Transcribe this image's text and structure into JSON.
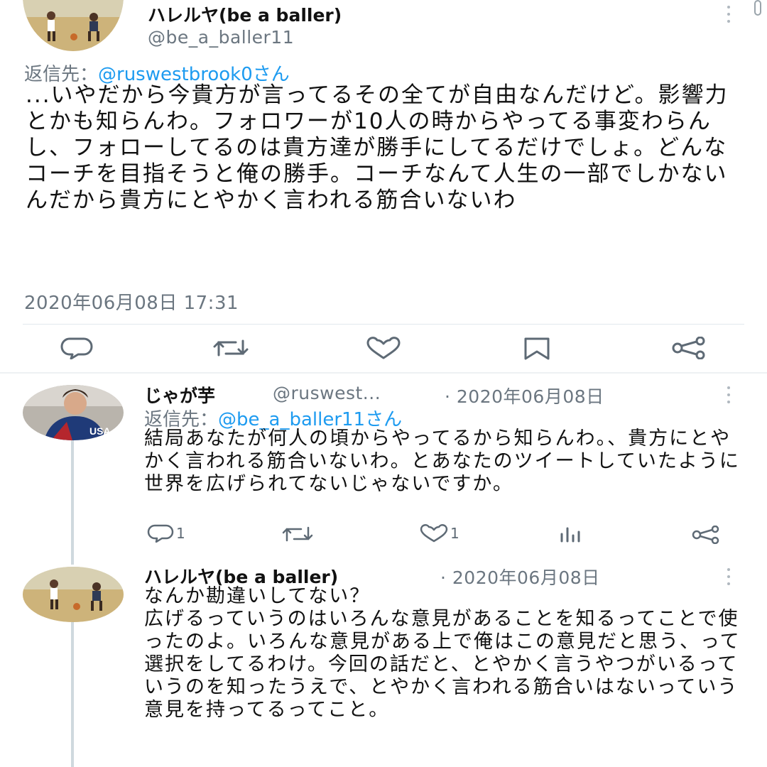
{
  "main_tweet": {
    "display_name": "ハレルヤ(be a baller)",
    "handle": "@be_a_baller11",
    "reply_prefix": "返信先：",
    "reply_to": "@ruswestbrook0さん",
    "text": "...いやだから今貴方が言ってるその全てが自由なんだけど。影響力とかも知らんわ。フォロワーが10人の時からやってる事変わらんし、フォローしてるのは貴方達が勝手にしてるだけでしょ。どんなコーチを目指そうと俺の勝手。コーチなんて人生の一部でしかないんだから貴方にとやかく言われる筋合いないわ",
    "timestamp": "2020年06月08日 17:31",
    "actions": [
      "reply-icon",
      "retweet-icon",
      "like-icon",
      "bookmark-icon",
      "share-icon"
    ]
  },
  "replies": [
    {
      "display_name": "じゃが芋",
      "handle": "@ruswest...",
      "date": "· 2020年06月08日",
      "reply_prefix": "返信先：",
      "reply_to": "@be_a_baller11さん",
      "text": "結局あなたが何人の頃からやってるから知らんわ。、貴方にとやかく言われる筋合いないわ。とあなたのツイートしていたように世界を広げられてないじゃないですか。",
      "reply_count": "1",
      "retweet_count": "",
      "like_count": "1"
    },
    {
      "display_name": "ハレルヤ(be a baller)",
      "date": "· 2020年06月08日",
      "text_lines": [
        "なんか勘違いしてない？",
        "広げるっていうのはいろんな意見があることを知るってことで使ったのよ。いろんな意見がある上で俺はこの意見だと思う、って選択をしてるわけ。今回の話だと、とやかく言うやつがいるっていうのを知ったうえで、とやかく言われる筋合いはないっていう意見を持ってるってこと。"
      ]
    }
  ],
  "colors": {
    "link": "#1d9bf0",
    "secondary_text": "#6b7680",
    "icon": "#5e6a75",
    "divider": "#e1e8ed"
  }
}
